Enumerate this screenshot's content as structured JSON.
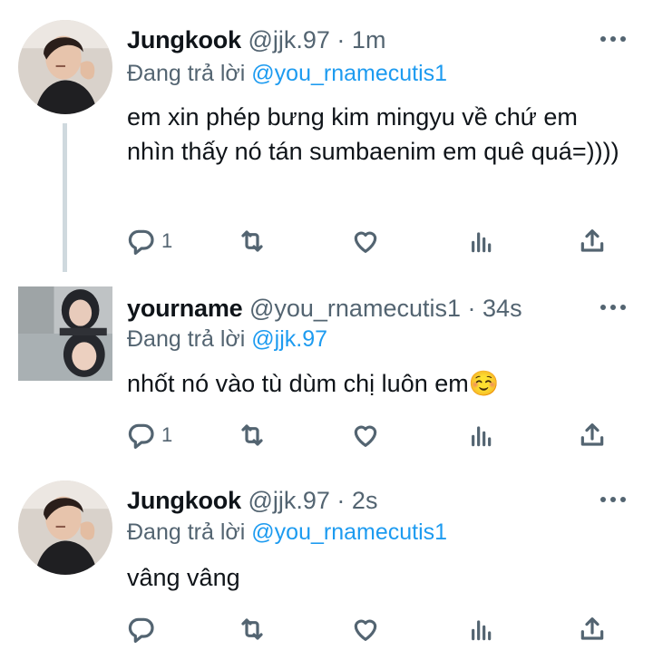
{
  "tweets": [
    {
      "name": "Jungkook",
      "handle": "@jjk.97",
      "separator": "·",
      "time": "1m",
      "reply_prefix": "Đang trả lời",
      "reply_to": "@you_rnamecutis1",
      "text": "em xin phép bưng kim mingyu về chứ em nhìn thấy nó tán sumbaenim em quê quá=))))",
      "reply_count": "1",
      "icons": [
        "reply-icon",
        "retweet-icon",
        "like-icon",
        "stats-icon",
        "share-icon",
        "more-icon"
      ]
    },
    {
      "name": "yourname",
      "handle": "@you_rnamecutis1",
      "separator": "·",
      "time": "34s",
      "reply_prefix": "Đang trả lời",
      "reply_to": "@jjk.97",
      "text": "nhốt nó vào tù dùm chị luôn em☺️",
      "reply_count": "1",
      "icons": [
        "reply-icon",
        "retweet-icon",
        "like-icon",
        "stats-icon",
        "share-icon",
        "more-icon"
      ]
    },
    {
      "name": "Jungkook",
      "handle": "@jjk.97",
      "separator": "·",
      "time": "2s",
      "reply_prefix": "Đang trả lời",
      "reply_to": "@you_rnamecutis1",
      "text": "vâng vâng",
      "reply_count": "",
      "icons": [
        "reply-icon",
        "retweet-icon",
        "like-icon",
        "stats-icon",
        "share-icon",
        "more-icon"
      ]
    }
  ],
  "colors": {
    "text": "#0f1419",
    "secondary": "#536471",
    "link": "#1d9bf0",
    "thread_line": "#cfd9de"
  }
}
